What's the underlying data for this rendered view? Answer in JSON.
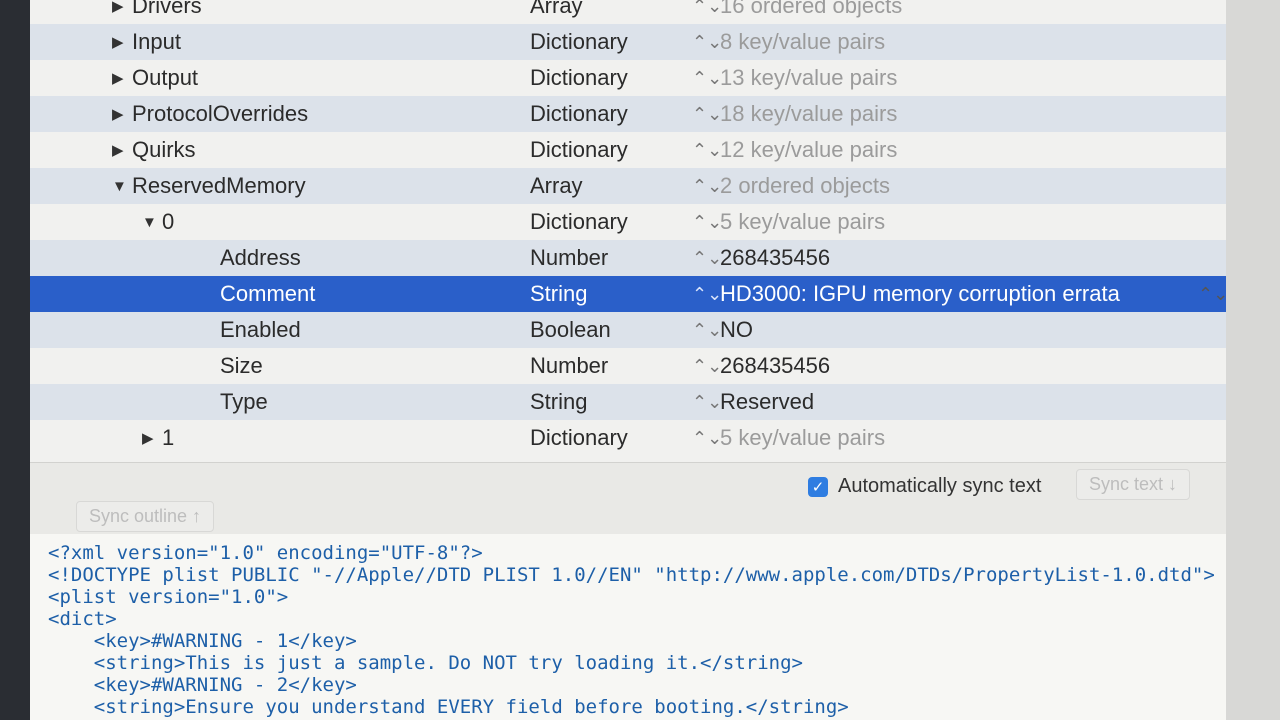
{
  "outline": {
    "rows": [
      {
        "key": "Drivers",
        "indent": 0,
        "disclosure": "right",
        "type": "Array",
        "value": "16 ordered objects",
        "value_dim": true
      },
      {
        "key": "Input",
        "indent": 0,
        "disclosure": "right",
        "type": "Dictionary",
        "value": "8 key/value pairs",
        "value_dim": true
      },
      {
        "key": "Output",
        "indent": 0,
        "disclosure": "right",
        "type": "Dictionary",
        "value": "13 key/value pairs",
        "value_dim": true
      },
      {
        "key": "ProtocolOverrides",
        "indent": 0,
        "disclosure": "right",
        "type": "Dictionary",
        "value": "18 key/value pairs",
        "value_dim": true
      },
      {
        "key": "Quirks",
        "indent": 0,
        "disclosure": "right",
        "type": "Dictionary",
        "value": "12 key/value pairs",
        "value_dim": true
      },
      {
        "key": "ReservedMemory",
        "indent": 0,
        "disclosure": "down",
        "type": "Array",
        "value": "2 ordered objects",
        "value_dim": true
      },
      {
        "key": "0",
        "indent": 1,
        "disclosure": "down",
        "type": "Dictionary",
        "value": "5 key/value pairs",
        "value_dim": true
      },
      {
        "key": "Address",
        "indent": 2,
        "disclosure": "none",
        "type": "Number",
        "value": "268435456",
        "value_dim": false
      },
      {
        "key": "Comment",
        "indent": 2,
        "disclosure": "none",
        "type": "String",
        "value": "HD3000: IGPU memory corruption errata",
        "value_dim": false,
        "selected": true
      },
      {
        "key": "Enabled",
        "indent": 2,
        "disclosure": "none",
        "type": "Boolean",
        "value": "NO",
        "value_dim": false
      },
      {
        "key": "Size",
        "indent": 2,
        "disclosure": "none",
        "type": "Number",
        "value": "268435456",
        "value_dim": false
      },
      {
        "key": "Type",
        "indent": 2,
        "disclosure": "none",
        "type": "String",
        "value": "Reserved",
        "value_dim": false
      },
      {
        "key": "1",
        "indent": 1,
        "disclosure": "right",
        "type": "Dictionary",
        "value": "5 key/value pairs",
        "value_dim": true
      }
    ]
  },
  "sync": {
    "auto_sync_label": "Automatically sync text",
    "auto_sync_checked": true,
    "sync_text_label": "Sync text ↓",
    "sync_outline_label": "Sync outline ↑"
  },
  "xml": {
    "lines": [
      "<?xml version=\"1.0\" encoding=\"UTF-8\"?>",
      "<!DOCTYPE plist PUBLIC \"-//Apple//DTD PLIST 1.0//EN\" \"http://www.apple.com/DTDs/PropertyList-1.0.dtd\">",
      "<plist version=\"1.0\">",
      "<dict>",
      "    <key>#WARNING - 1</key>",
      "    <string>This is just a sample. Do NOT try loading it.</string>",
      "    <key>#WARNING - 2</key>",
      "    <string>Ensure you understand EVERY field before booting.</string>"
    ]
  },
  "icons": {
    "disclosure_right": "▶",
    "disclosure_down": "▼",
    "stepper": "⌃⌄",
    "check": "✓"
  },
  "colors": {
    "selection": "#2a5fc9",
    "alt_row": "#dce2ea",
    "xml_tag": "#1d5fa8",
    "checkbox": "#2f7de1"
  }
}
